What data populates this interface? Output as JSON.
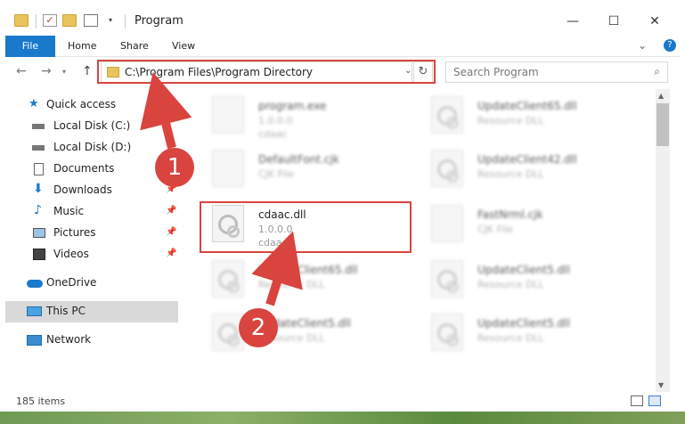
{
  "window": {
    "title": "Program"
  },
  "ribbon": {
    "tabs": [
      "File",
      "Home",
      "Share",
      "View"
    ]
  },
  "address": {
    "path": "C:\\Program Files\\Program Directory",
    "search_placeholder": "Search Program"
  },
  "nav": {
    "items": [
      {
        "label": "Quick access",
        "icon": "star-icon",
        "pinned": false
      },
      {
        "label": "Local Disk (C:)",
        "icon": "drive-icon",
        "pinned": false
      },
      {
        "label": "Local Disk (D:)",
        "icon": "drive-icon",
        "pinned": false
      },
      {
        "label": "Documents",
        "icon": "document-icon",
        "pinned": false
      },
      {
        "label": "Downloads",
        "icon": "download-icon",
        "pinned": true
      },
      {
        "label": "Music",
        "icon": "music-icon",
        "pinned": true
      },
      {
        "label": "Pictures",
        "icon": "pictures-icon",
        "pinned": true
      },
      {
        "label": "Videos",
        "icon": "video-icon",
        "pinned": true
      },
      {
        "label": "OneDrive",
        "icon": "cloud-icon",
        "pinned": false
      },
      {
        "label": "This PC",
        "icon": "computer-icon",
        "pinned": false,
        "selected": true
      },
      {
        "label": "Network",
        "icon": "network-icon",
        "pinned": false
      }
    ]
  },
  "files": [
    {
      "name": "program.exe",
      "line1": "1.0.0.0",
      "line2": "cdaac",
      "kind": "exe",
      "blurred": true
    },
    {
      "name": "UpdateClient65.dll",
      "line1": "Resource DLL",
      "line2": "",
      "kind": "dll",
      "blurred": true
    },
    {
      "name": "DefaultFont.cjk",
      "line1": "CJK File",
      "line2": "",
      "kind": "file",
      "blurred": true
    },
    {
      "name": "UpdateClient42.dll",
      "line1": "Resource DLL",
      "line2": "",
      "kind": "dll",
      "blurred": true
    },
    {
      "name": "cdaac.dll",
      "line1": "1.0.0.0",
      "line2": "cdaac",
      "kind": "dll",
      "blurred": false,
      "highlighted": true
    },
    {
      "name": "FastNrml.cjk",
      "line1": "CJK File",
      "line2": "",
      "kind": "file",
      "blurred": true
    },
    {
      "name": "UpdateClient65.dll",
      "line1": "Resource DLL",
      "line2": "",
      "kind": "dll",
      "blurred": true
    },
    {
      "name": "UpdateClient5.dll",
      "line1": "Resource DLL",
      "line2": "",
      "kind": "dll",
      "blurred": true
    },
    {
      "name": "UpdateClient5.dll",
      "line1": "Resource DLL",
      "line2": "",
      "kind": "dll",
      "blurred": true
    },
    {
      "name": "UpdateClient5.dll",
      "line1": "Resource DLL",
      "line2": "",
      "kind": "dll",
      "blurred": true
    }
  ],
  "status": {
    "count": "185 items"
  },
  "annotations": {
    "step1": "1",
    "step2": "2",
    "color": "#d9443f"
  }
}
